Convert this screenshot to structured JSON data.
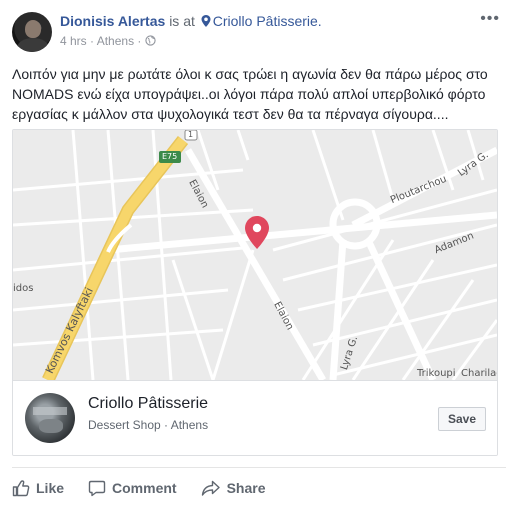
{
  "post": {
    "author": "Dionisis Alertas",
    "is_at": "is at",
    "place": "Criollo Pâtisserie.",
    "time": "4 hrs",
    "separator": "·",
    "location": "Athens",
    "privacy_icon": "globe-icon",
    "more_icon": "more-dots-icon",
    "more_glyph": "•••",
    "text": "Λοιπόν για μην με ρωτάτε όλοι κ σας τρώει η αγωνία δεν θα πάρω μέρος στο NOMADS ενώ είχα υπογράψει..οι λόγοι πάρα πολύ απλοί υπερβολικό φόρτο εργασίας κ μάλλον στα ψυχολογικά τεστ δεν θα τα πέρναγα σίγουρα...."
  },
  "map": {
    "labels": {
      "e75": "E75",
      "route1": "1",
      "elaion_top": "Elaion",
      "elaion_bottom": "Elaion",
      "kalyftaki": "Komvos Kalyftaki",
      "ploutarchou": "Ploutarchou",
      "lyra_top": "Lyra G.",
      "adamon": "Adamon",
      "lyra_bottom": "Lyra G.",
      "trikoupi": "Trikoupi",
      "charilaou": "Charilaou",
      "idos": "idos"
    },
    "pin_color": "#e0475d",
    "highway_color": "#f7d66b"
  },
  "place_card": {
    "name": "Criollo Pâtisserie",
    "category": "Dessert Shop",
    "separator": "·",
    "city": "Athens",
    "save_label": "Save"
  },
  "actions": {
    "like": "Like",
    "comment": "Comment",
    "share": "Share"
  }
}
